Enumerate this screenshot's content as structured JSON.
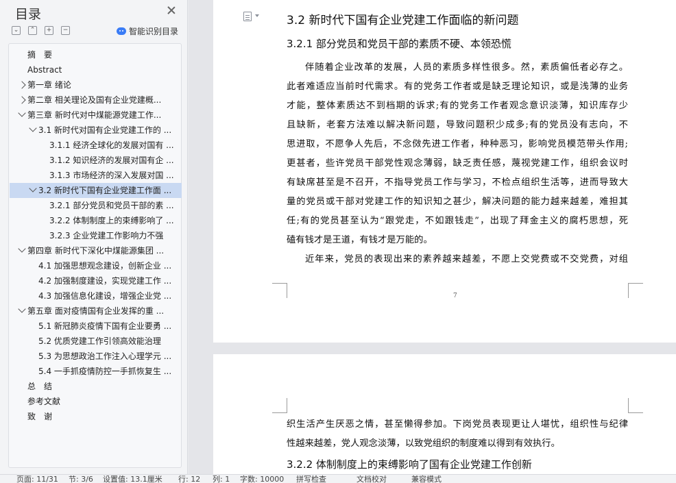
{
  "toc": {
    "title": "目录",
    "controls": {
      "collapse": "⌄",
      "expand": "⌃",
      "add": "+",
      "remove": "−"
    },
    "smart_label": "智能识别目录",
    "items": [
      {
        "label": "摘　要",
        "level": 0,
        "arrow": "none"
      },
      {
        "label": "Abstract",
        "level": 0,
        "arrow": "none"
      },
      {
        "label": "第一章  绪论",
        "level": 0,
        "arrow": "right"
      },
      {
        "label": "第二章  相关理论及国有企业党建概...",
        "level": 0,
        "arrow": "right"
      },
      {
        "label": "第三章  新时代对中煤能源党建工作...",
        "level": 0,
        "arrow": "down"
      },
      {
        "label": "3.1 新时代对国有企业党建工作的 ...",
        "level": 1,
        "arrow": "down"
      },
      {
        "label": "3.1.1 经济全球化的发展对国有 ...",
        "level": 2,
        "arrow": "none"
      },
      {
        "label": "3.1.2 知识经济的发展对国有企 ...",
        "level": 2,
        "arrow": "none"
      },
      {
        "label": "3.1.3 市场经济的深入发展对国 ...",
        "level": 2,
        "arrow": "none"
      },
      {
        "label": "3.2 新时代下国有企业党建工作面 ...",
        "level": 1,
        "arrow": "down",
        "selected": true
      },
      {
        "label": "3.2.1 部分党员和党员干部的素 ...",
        "level": 2,
        "arrow": "none"
      },
      {
        "label": "3.2.2 体制制度上的束缚影响了 ...",
        "level": 2,
        "arrow": "none"
      },
      {
        "label": "3.2.3 企业党建工作影响力不强",
        "level": 2,
        "arrow": "none"
      },
      {
        "label": "第四章  新时代下深化中煤能源集团 ...",
        "level": 0,
        "arrow": "down"
      },
      {
        "label": "4.1 加强思想观念建设，创新企业 ...",
        "level": 1,
        "arrow": "none"
      },
      {
        "label": "4.2 加强制度建设，实现党建工作 ...",
        "level": 1,
        "arrow": "none"
      },
      {
        "label": "4.3 加强信息化建设，增强企业党 ...",
        "level": 1,
        "arrow": "none"
      },
      {
        "label": "第五章  面对疫情国有企业发挥的重 ...",
        "level": 0,
        "arrow": "down"
      },
      {
        "label": "5.1 新冠肺炎疫情下国有企业要勇 ...",
        "level": 1,
        "arrow": "none"
      },
      {
        "label": "5.2 优质党建工作引领高效能治理",
        "level": 1,
        "arrow": "none"
      },
      {
        "label": "5.3 为思想政治工作注入心理学元 ...",
        "level": 1,
        "arrow": "none"
      },
      {
        "label": "5.4 一手抓疫情防控一手抓恢复生 ...",
        "level": 1,
        "arrow": "none"
      },
      {
        "label": "总　结",
        "level": 0,
        "arrow": "none"
      },
      {
        "label": "参考文献",
        "level": 0,
        "arrow": "none"
      },
      {
        "label": "致　谢",
        "level": 0,
        "arrow": "none"
      }
    ]
  },
  "document": {
    "page1": {
      "heading2": "3.2 新时代下国有企业党建工作面临的新问题",
      "heading3": "3.2.1 部分党员和党员干部的素质不硬、本领恐慌",
      "para1_lines": [
        "伴随着企业改革的发展，人员的素质多样性很多。然，素质偏低者必存之。",
        "此者难适应当前时代需求。有的党务工作者或是缺乏理论知识，或是浅薄的业务",
        "才能，整体素质达不到档期的诉求;有的党务工作者观念意识淡薄，知识库存少",
        "且缺新，老套方法难以解决新问题，导致问题积少成多;有的党员没有志向，不",
        "思进取，不愿争人先后，不念傚先进工作者，种种恶习，影响党员模范带头作用;",
        "更甚者，些许党员干部党性观念薄弱，缺乏责任感，蔑视党建工作，组织会议时",
        "有缺席甚至是不召开，不指导党员工作与学习，不检点组织生活等，进而导致大",
        "量的党员或干部对党建工作的知识知之甚少，解决问题的能力越来越差，难担其",
        "任;有的党员甚至认为“跟党走，不如跟钱走”，出现了拜金主义的腐朽思想，死",
        "磕有钱才是王道，有钱才是万能的。"
      ],
      "para2_first_line": "近年来，党员的表现出来的素养越来越差，不愿上交党费或不交党费，对组",
      "page_number": "7"
    },
    "page2": {
      "para_lines": [
        "织生活产生厌恶之情，甚至懒得参加。下岗党员表现更让人堪忧，组织性与纪律",
        "性越来越差，党人观念淡薄，以致党组织的制度难以得到有效执行。"
      ],
      "heading3": "3.2.2 体制制度上的束缚影响了国有企业党建工作创新"
    }
  },
  "status_bar": {
    "page": "页面: 11/31",
    "section": "节: 3/6",
    "row": "设置值: 13.1厘米",
    "line": "行: 12",
    "col": "列: 1",
    "words": "字数: 10000",
    "spell": "拼写检查",
    "revision": "文档校对",
    "mode": "兼容模式"
  }
}
